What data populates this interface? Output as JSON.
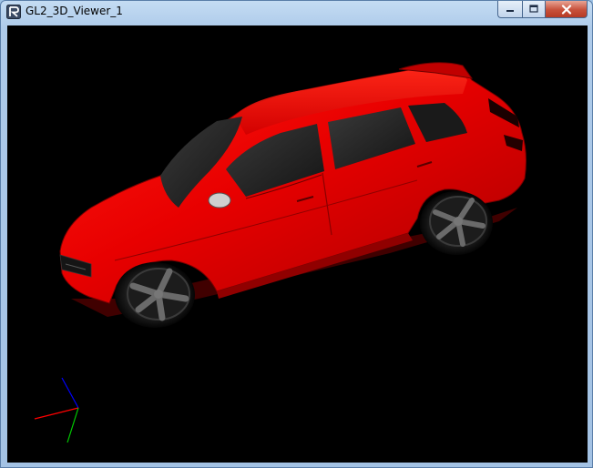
{
  "window": {
    "title": "GL2_3D_Viewer_1"
  },
  "titlebar": {
    "app_icon": "r-logo-icon",
    "buttons": {
      "minimize_icon": "minimize-icon",
      "maximize_icon": "maximize-icon",
      "close_icon": "close-icon"
    }
  },
  "viewport": {
    "background": "#000000",
    "model_color": "#e00000",
    "axis_colors": {
      "x": "#ff0000",
      "y": "#00cc00",
      "z": "#0000ff"
    }
  }
}
